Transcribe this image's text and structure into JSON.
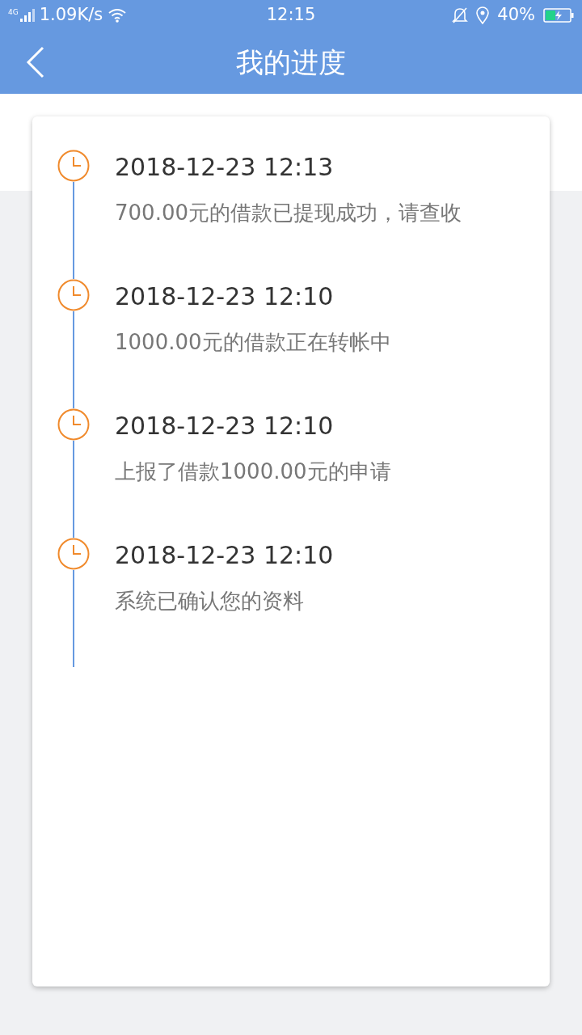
{
  "status_bar": {
    "network": "4G",
    "speed": "1.09K/s",
    "time": "12:15",
    "battery": "40%"
  },
  "header": {
    "title": "我的进度"
  },
  "timeline": [
    {
      "time": "2018-12-23 12:13",
      "text": "700.00元的借款已提现成功，请查收"
    },
    {
      "time": "2018-12-23 12:10",
      "text": "1000.00元的借款正在转帐中"
    },
    {
      "time": "2018-12-23 12:10",
      "text": "上报了借款1000.00元的申请"
    },
    {
      "time": "2018-12-23 12:10",
      "text": "系统已确认您的资料"
    }
  ]
}
